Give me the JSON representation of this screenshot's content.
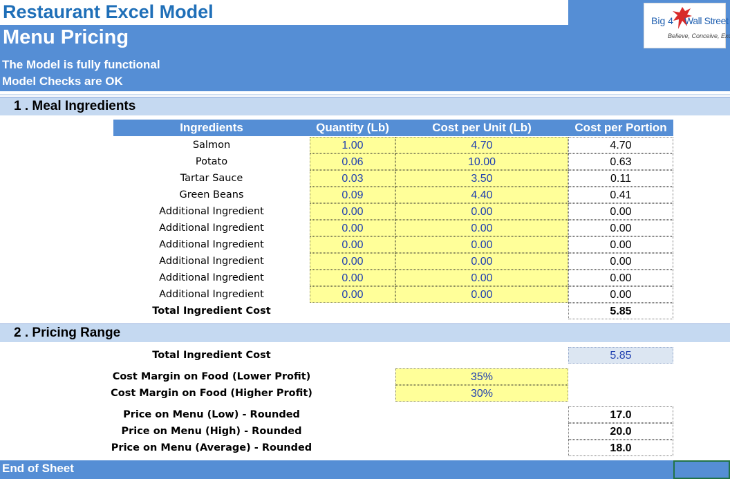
{
  "header": {
    "app_title": "Restaurant Excel Model",
    "subtitle": "Menu Pricing",
    "status_functional": "The Model is fully functional",
    "status_checks": "Model Checks are OK",
    "logo_big4": "Big 4",
    "logo_wallstreet": "Wall Street",
    "logo_tagline": "Believe, Conceive, Excel"
  },
  "colors": {
    "header_blue": "#558ed5",
    "title_blue": "#1f6fb8",
    "section_band": "#c5d9f1",
    "input_yellow": "#ffff99",
    "input_text": "#1f3fb0"
  },
  "section1": {
    "label": "1 . Meal Ingredients",
    "headers": [
      "Ingredients",
      "Quantity (Lb)",
      "Cost per Unit (Lb)",
      "Cost per Portion"
    ],
    "rows": [
      {
        "name": "Salmon",
        "qty": "1.00",
        "unit_cost": "4.70",
        "portion": "4.70"
      },
      {
        "name": "Potato",
        "qty": "0.06",
        "unit_cost": "10.00",
        "portion": "0.63"
      },
      {
        "name": "Tartar Sauce",
        "qty": "0.03",
        "unit_cost": "3.50",
        "portion": "0.11"
      },
      {
        "name": "Green Beans",
        "qty": "0.09",
        "unit_cost": "4.40",
        "portion": "0.41"
      },
      {
        "name": "Additional Ingredient",
        "qty": "0.00",
        "unit_cost": "0.00",
        "portion": "0.00"
      },
      {
        "name": "Additional Ingredient",
        "qty": "0.00",
        "unit_cost": "0.00",
        "portion": "0.00"
      },
      {
        "name": "Additional Ingredient",
        "qty": "0.00",
        "unit_cost": "0.00",
        "portion": "0.00"
      },
      {
        "name": "Additional Ingredient",
        "qty": "0.00",
        "unit_cost": "0.00",
        "portion": "0.00"
      },
      {
        "name": "Additional Ingredient",
        "qty": "0.00",
        "unit_cost": "0.00",
        "portion": "0.00"
      },
      {
        "name": "Additional Ingredient",
        "qty": "0.00",
        "unit_cost": "0.00",
        "portion": "0.00"
      }
    ],
    "total_label": "Total Ingredient Cost",
    "total_value": "5.85"
  },
  "section2": {
    "label": "2 . Pricing Range",
    "total_label": "Total Ingredient Cost",
    "total_value": "5.85",
    "margin_low_label": "Cost Margin on Food (Lower Profit)",
    "margin_low_value": "35%",
    "margin_high_label": "Cost Margin on Food (Higher Profit)",
    "margin_high_value": "30%",
    "price_low_label": "Price on Menu (Low) - Rounded",
    "price_low_value": "17.0",
    "price_high_label": "Price on Menu (High) - Rounded",
    "price_high_value": "20.0",
    "price_avg_label": "Price on Menu (Average) - Rounded",
    "price_avg_value": "18.0"
  },
  "footer": {
    "label": "End of Sheet"
  }
}
